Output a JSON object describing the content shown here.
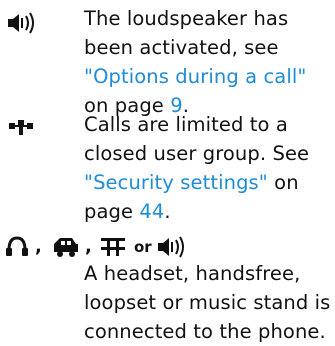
{
  "entries": [
    {
      "icon": "loudspeaker-icon",
      "text_1": "The loudspeaker has been activated, see ",
      "link": "\"Options during a call\"",
      "text_2": " on page ",
      "page": "9",
      "text_3": "."
    },
    {
      "icon": "closed-user-group-icon",
      "text_1": "Calls are limited to a closed user group. See ",
      "link": "\"Security settings\"",
      "text_2": " on page ",
      "page": "44",
      "text_3": "."
    },
    {
      "icons": [
        "headset-icon",
        "handsfree-icon",
        "loopset-icon",
        "loudspeaker-icon"
      ],
      "separator": ",",
      "conjunction": "or",
      "text": "A headset, handsfree, loopset or music stand is connected to the phone."
    }
  ],
  "colors": {
    "link": "#1e8cd6",
    "text": "#111111"
  }
}
